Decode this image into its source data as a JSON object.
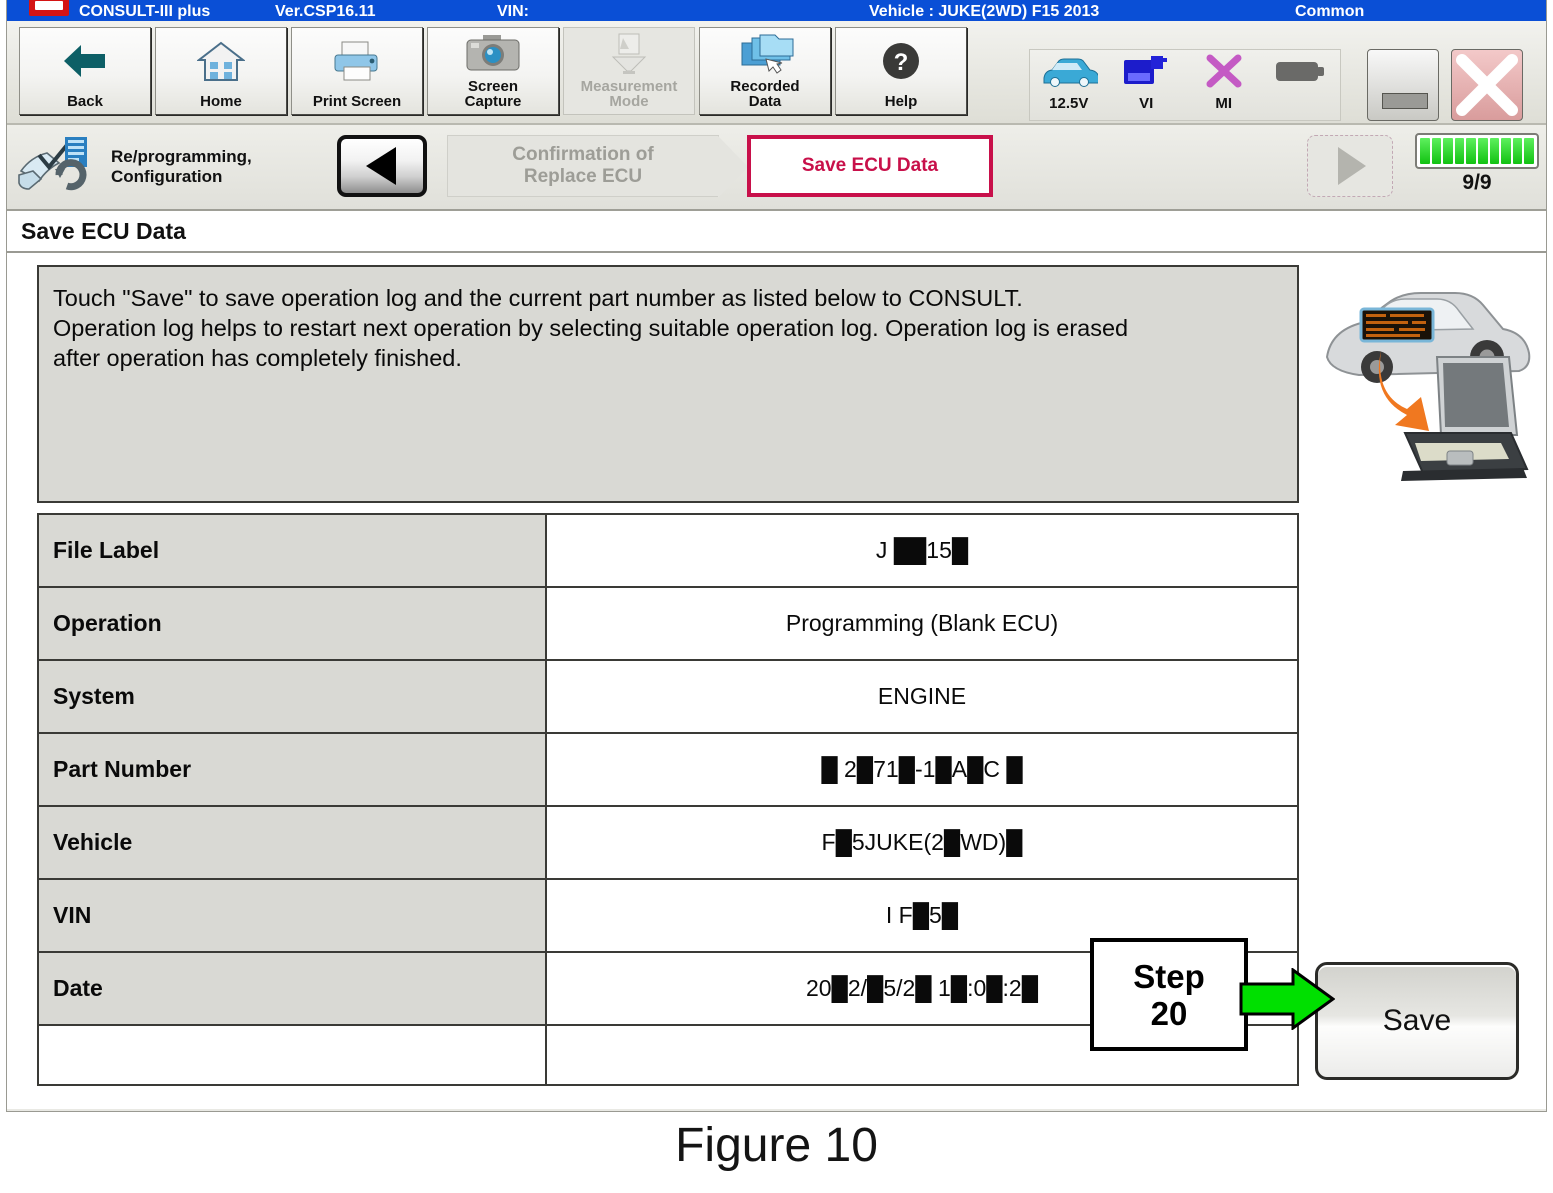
{
  "titlebar": {
    "app_name": "CONSULT-III plus",
    "version": "Ver.CSP16.11",
    "vin_label": "VIN:",
    "vehicle_label": "Vehicle : JUKE(2WD) F15 2013",
    "mode_label": "Common",
    "logo_icon": "nissan-logo-icon"
  },
  "toolbar": {
    "buttons": [
      {
        "label": "Back",
        "icon": "back-arrow-icon",
        "disabled": false
      },
      {
        "label": "Home",
        "icon": "home-icon",
        "disabled": false
      },
      {
        "label": "Print Screen",
        "icon": "printer-icon",
        "disabled": false
      },
      {
        "label": "Screen\nCapture",
        "line1": "Screen",
        "line2": "Capture",
        "icon": "camera-icon",
        "disabled": false
      },
      {
        "label": "Measurement\nMode",
        "line1": "Measurement",
        "line2": "Mode",
        "icon": "measurement-icon",
        "disabled": true
      },
      {
        "label": "Recorded\nData",
        "line1": "Recorded",
        "line2": "Data",
        "icon": "folders-icon",
        "disabled": false
      },
      {
        "label": "Help",
        "icon": "question-mark-icon",
        "disabled": false
      }
    ],
    "status": [
      {
        "label": "12.5V",
        "icon": "car-icon"
      },
      {
        "label": "VI",
        "icon": "vehicle-interface-icon"
      },
      {
        "label": "MI",
        "icon": "measurement-interface-x-icon"
      },
      {
        "label": "",
        "icon": "battery-icon"
      }
    ],
    "window_buttons": {
      "minimize": "minimize-icon",
      "close": "close-x-icon"
    }
  },
  "navbar": {
    "mode_line1": "Re/programming,",
    "mode_line2": "Configuration",
    "mode_icon": "reprogramming-icon",
    "back_button_icon": "left-triangle-icon",
    "breadcrumbs": [
      {
        "line1": "Confirmation of",
        "line2": "Replace ECU",
        "state": "inactive"
      },
      {
        "line1": "Save ECU Data",
        "line2": "",
        "state": "active"
      }
    ],
    "forward_button_icon": "right-triangle-icon",
    "progress_segments": 10,
    "progress_text": "9/9",
    "active_color": "#c8104a"
  },
  "page_title": "Save ECU Data",
  "info_box": {
    "line1": "Touch \"Save\" to save operation log and the current part number as listed below to CONSULT.",
    "line2": "Operation log helps to restart next operation by selecting suitable operation log. Operation log is erased",
    "line3": "after operation has completely finished."
  },
  "illustration": {
    "name": "car-to-laptop-data-transfer-illustration",
    "arrow_color": "#f07820"
  },
  "table": {
    "rows": [
      {
        "key": "File Label",
        "value": "J  ██15█"
      },
      {
        "key": "Operation",
        "value": "Programming (Blank ECU)"
      },
      {
        "key": "System",
        "value": "ENGINE"
      },
      {
        "key": "Part Number",
        "value": "█ 2█71█-1█A█C █"
      },
      {
        "key": "Vehicle",
        "value": "F█5JUKE(2█WD)█"
      },
      {
        "key": "VIN",
        "value": "I  F█5█"
      },
      {
        "key": "Date",
        "value": "20█2/█5/2█ 1█:0█:2█"
      }
    ]
  },
  "callout": {
    "line1": "Step",
    "line2": "20",
    "arrow_icon": "green-right-arrow-icon",
    "arrow_color": "#00e000"
  },
  "save_button": {
    "label": "Save"
  },
  "figure_caption": "Figure 10"
}
